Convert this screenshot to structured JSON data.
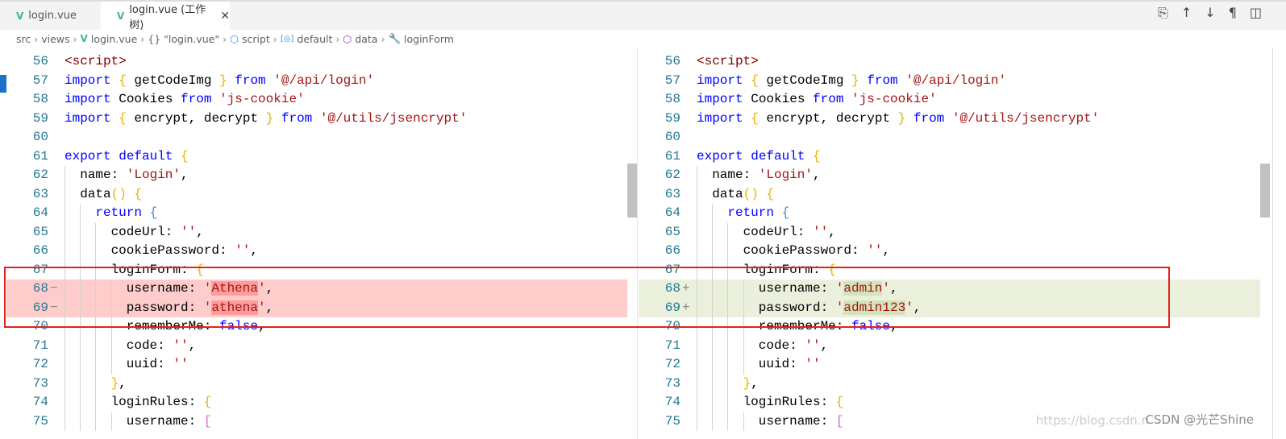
{
  "tabs": [
    {
      "label": "login.vue",
      "active": false
    },
    {
      "label": "login.vue (工作树)",
      "active": true
    }
  ],
  "tab_icons": [
    "open-changes-icon",
    "arrow-up-icon",
    "arrow-down-icon",
    "pilcrow-icon",
    "split-editor-icon"
  ],
  "breadcrumb": [
    "src",
    "views",
    "login.vue",
    "{} \"login.vue\"",
    "script",
    "default",
    "data",
    "loginForm"
  ],
  "left": {
    "lines": [
      {
        "n": "56",
        "t": [
          [
            "<script>",
            "t"
          ]
        ]
      },
      {
        "n": "57",
        "t": [
          [
            "import ",
            "k"
          ],
          [
            "{ ",
            "b1"
          ],
          [
            "getCodeImg ",
            "p"
          ],
          [
            "} ",
            "b1"
          ],
          [
            "from ",
            "k"
          ],
          [
            "'@/api/login'",
            "s"
          ]
        ]
      },
      {
        "n": "58",
        "t": [
          [
            "import ",
            "k"
          ],
          [
            "Cookies ",
            "p"
          ],
          [
            "from ",
            "k"
          ],
          [
            "'js-cookie'",
            "s"
          ]
        ]
      },
      {
        "n": "59",
        "t": [
          [
            "import ",
            "k"
          ],
          [
            "{ ",
            "b1"
          ],
          [
            "encrypt, decrypt ",
            "p"
          ],
          [
            "} ",
            "b1"
          ],
          [
            "from ",
            "k"
          ],
          [
            "'@/utils/jsencrypt'",
            "s"
          ]
        ]
      },
      {
        "n": "60",
        "t": []
      },
      {
        "n": "61",
        "t": [
          [
            "export ",
            "k"
          ],
          [
            "default ",
            "k"
          ],
          [
            "{",
            "b1"
          ]
        ]
      },
      {
        "n": "62",
        "i": 1,
        "t": [
          [
            "name: ",
            "p"
          ],
          [
            "'Login'",
            "s"
          ],
          [
            ",",
            "p"
          ]
        ]
      },
      {
        "n": "63",
        "i": 1,
        "t": [
          [
            "data",
            "p"
          ],
          [
            "() {",
            "b1"
          ]
        ]
      },
      {
        "n": "64",
        "i": 2,
        "t": [
          [
            "return ",
            "k"
          ],
          [
            "{",
            "b3"
          ]
        ]
      },
      {
        "n": "65",
        "i": 3,
        "t": [
          [
            "codeUrl: ",
            "p"
          ],
          [
            "''",
            "s"
          ],
          [
            ",",
            "p"
          ]
        ]
      },
      {
        "n": "66",
        "i": 3,
        "t": [
          [
            "cookiePassword: ",
            "p"
          ],
          [
            "''",
            "s"
          ],
          [
            ",",
            "p"
          ]
        ]
      },
      {
        "n": "67",
        "i": 3,
        "t": [
          [
            "loginForm: ",
            "p"
          ],
          [
            "{",
            "b1"
          ]
        ]
      },
      {
        "n": "68",
        "i": 4,
        "d": "del",
        "m": "−",
        "t": [
          [
            "username: ",
            "p"
          ],
          [
            "'",
            "s"
          ],
          [
            "Athena",
            "s hl"
          ],
          [
            "'",
            "s"
          ],
          [
            ",",
            "p"
          ]
        ]
      },
      {
        "n": "69",
        "i": 4,
        "d": "del",
        "m": "−",
        "t": [
          [
            "password: ",
            "p"
          ],
          [
            "'",
            "s"
          ],
          [
            "athena",
            "s hl"
          ],
          [
            "'",
            "s"
          ],
          [
            ",",
            "p"
          ]
        ]
      },
      {
        "n": "70",
        "i": 4,
        "t": [
          [
            "rememberMe: ",
            "p"
          ],
          [
            "false",
            "k"
          ],
          [
            ",",
            "p"
          ]
        ]
      },
      {
        "n": "71",
        "i": 4,
        "t": [
          [
            "code: ",
            "p"
          ],
          [
            "''",
            "s"
          ],
          [
            ",",
            "p"
          ]
        ]
      },
      {
        "n": "72",
        "i": 4,
        "t": [
          [
            "uuid: ",
            "p"
          ],
          [
            "''",
            "s"
          ]
        ]
      },
      {
        "n": "73",
        "i": 3,
        "t": [
          [
            "}",
            "b1"
          ],
          [
            ",",
            "p"
          ]
        ]
      },
      {
        "n": "74",
        "i": 3,
        "t": [
          [
            "loginRules: ",
            "p"
          ],
          [
            "{",
            "b1"
          ]
        ]
      },
      {
        "n": "75",
        "i": 4,
        "t": [
          [
            "username: ",
            "p"
          ],
          [
            "[",
            "b2"
          ]
        ]
      }
    ]
  },
  "right": {
    "lines": [
      {
        "n": "56",
        "t": [
          [
            "<script>",
            "t"
          ]
        ]
      },
      {
        "n": "57",
        "t": [
          [
            "import ",
            "k"
          ],
          [
            "{ ",
            "b1"
          ],
          [
            "getCodeImg ",
            "p"
          ],
          [
            "} ",
            "b1"
          ],
          [
            "from ",
            "k"
          ],
          [
            "'@/api/login'",
            "s"
          ]
        ]
      },
      {
        "n": "58",
        "t": [
          [
            "import ",
            "k"
          ],
          [
            "Cookies ",
            "p"
          ],
          [
            "from ",
            "k"
          ],
          [
            "'js-cookie'",
            "s"
          ]
        ]
      },
      {
        "n": "59",
        "t": [
          [
            "import ",
            "k"
          ],
          [
            "{ ",
            "b1"
          ],
          [
            "encrypt, decrypt ",
            "p"
          ],
          [
            "} ",
            "b1"
          ],
          [
            "from ",
            "k"
          ],
          [
            "'@/utils/jsencrypt'",
            "s"
          ]
        ]
      },
      {
        "n": "60",
        "t": []
      },
      {
        "n": "61",
        "t": [
          [
            "export ",
            "k"
          ],
          [
            "default ",
            "k"
          ],
          [
            "{",
            "b1"
          ]
        ]
      },
      {
        "n": "62",
        "i": 1,
        "t": [
          [
            "name: ",
            "p"
          ],
          [
            "'Login'",
            "s"
          ],
          [
            ",",
            "p"
          ]
        ]
      },
      {
        "n": "63",
        "i": 1,
        "t": [
          [
            "data",
            "p"
          ],
          [
            "() {",
            "b1"
          ]
        ]
      },
      {
        "n": "64",
        "i": 2,
        "t": [
          [
            "return ",
            "k"
          ],
          [
            "{",
            "b3"
          ]
        ]
      },
      {
        "n": "65",
        "i": 3,
        "t": [
          [
            "codeUrl: ",
            "p"
          ],
          [
            "''",
            "s"
          ],
          [
            ",",
            "p"
          ]
        ]
      },
      {
        "n": "66",
        "i": 3,
        "t": [
          [
            "cookiePassword: ",
            "p"
          ],
          [
            "''",
            "s"
          ],
          [
            ",",
            "p"
          ]
        ]
      },
      {
        "n": "67",
        "i": 3,
        "t": [
          [
            "loginForm: ",
            "p"
          ],
          [
            "{",
            "b1"
          ]
        ]
      },
      {
        "n": "68",
        "i": 4,
        "d": "ins",
        "m": "+",
        "t": [
          [
            "username: ",
            "p"
          ],
          [
            "'",
            "s"
          ],
          [
            "admin",
            "s hl"
          ],
          [
            "'",
            "s"
          ],
          [
            ",",
            "p"
          ]
        ]
      },
      {
        "n": "69",
        "i": 4,
        "d": "ins",
        "m": "+",
        "t": [
          [
            "password: ",
            "p"
          ],
          [
            "'",
            "s"
          ],
          [
            "admin123",
            "s hl"
          ],
          [
            "'",
            "s"
          ],
          [
            ",",
            "p"
          ]
        ]
      },
      {
        "n": "70",
        "i": 4,
        "t": [
          [
            "rememberMe: ",
            "p"
          ],
          [
            "false",
            "k"
          ],
          [
            ",",
            "p"
          ]
        ]
      },
      {
        "n": "71",
        "i": 4,
        "t": [
          [
            "code: ",
            "p"
          ],
          [
            "''",
            "s"
          ],
          [
            ",",
            "p"
          ]
        ]
      },
      {
        "n": "72",
        "i": 4,
        "t": [
          [
            "uuid: ",
            "p"
          ],
          [
            "''",
            "s"
          ]
        ]
      },
      {
        "n": "73",
        "i": 3,
        "t": [
          [
            "}",
            "b1"
          ],
          [
            ",",
            "p"
          ]
        ]
      },
      {
        "n": "74",
        "i": 3,
        "t": [
          [
            "loginRules: ",
            "p"
          ],
          [
            "{",
            "b1"
          ]
        ]
      },
      {
        "n": "75",
        "i": 4,
        "t": [
          [
            "username: ",
            "p"
          ],
          [
            "[",
            "b2"
          ]
        ]
      }
    ]
  },
  "watermark": "CSDN @光芒Shine",
  "watermark_url": "https://blog.csdn.n",
  "colors": {
    "deleted": "#ffcccc",
    "inserted": "#eaf0dc",
    "highlight_box": "#e8201a"
  }
}
